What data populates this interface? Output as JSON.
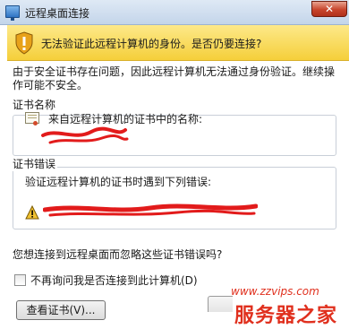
{
  "window": {
    "title": "远程桌面连接",
    "close_glyph": "✕"
  },
  "header": {
    "warning_title": "无法验证此远程计算机的身份。是否仍要连接?"
  },
  "description": "由于安全证书存在问题，因此远程计算机无法通过身份验证。继续操作可能不安全。",
  "cert_name": {
    "label": "证书名称",
    "text": "来自远程计算机的证书中的名称:"
  },
  "cert_errors": {
    "label": "证书错误",
    "text": "验证远程计算机的证书时遇到下列错误:"
  },
  "question": "您想连接到远程桌面而忽略这些证书错误吗?",
  "checkbox": {
    "label": "不再询问我是否连接到此计算机(D)",
    "checked": false
  },
  "buttons": {
    "view_cert": "查看证书(V)..."
  },
  "watermark": {
    "url": "www.zzvips.com",
    "brand": "服务器之家"
  },
  "colors": {
    "warning_band": "#f5cf3a",
    "redaction": "#e21b1b",
    "watermark": "#e0301e"
  }
}
